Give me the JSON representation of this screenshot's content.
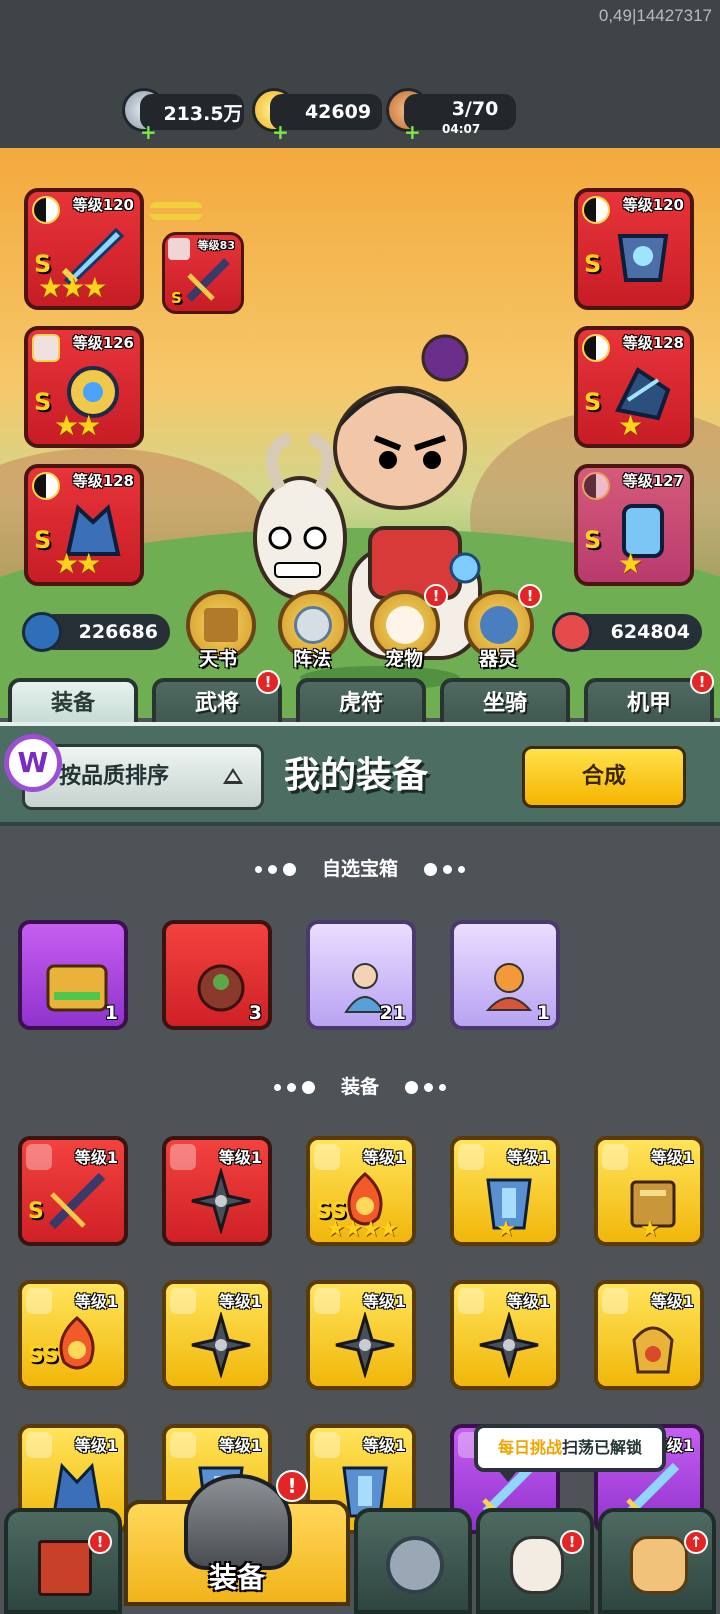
{
  "build_info": "0,49|14427317",
  "resources": {
    "silver": "213.5万",
    "gold": "42609",
    "stamina": "3/70",
    "stamina_timer": "04:07"
  },
  "hero_equipment": {
    "left": [
      {
        "level": "等级120",
        "rank": "S",
        "stars": "★★★",
        "icon": "sword-icon"
      },
      {
        "level": "等级126",
        "rank": "S",
        "stars": "★★",
        "icon": "armor-icon"
      },
      {
        "level": "等级128",
        "rank": "S",
        "stars": "★★",
        "icon": "helmet-icon"
      }
    ],
    "right": [
      {
        "level": "等级120",
        "rank": "S",
        "icon": "armor-icon"
      },
      {
        "level": "等级128",
        "rank": "S",
        "stars": "★",
        "icon": "boots-icon"
      },
      {
        "level": "等级127",
        "rank": "S",
        "stars": "★",
        "icon": "gauntlet-icon"
      }
    ],
    "linked_weapon_level": "等级83",
    "linked_weapon_rank": "S"
  },
  "stats": {
    "attack": "226686",
    "hp": "624804"
  },
  "skill_buttons": [
    {
      "label": "天书",
      "icon": "scroll-icon",
      "badge": false
    },
    {
      "label": "阵法",
      "icon": "formation-icon",
      "badge": false
    },
    {
      "label": "宠物",
      "icon": "cat-icon",
      "badge": true
    },
    {
      "label": "器灵",
      "icon": "spirit-icon",
      "badge": true
    }
  ],
  "tabs": [
    {
      "label": "装备",
      "active": true,
      "badge": false
    },
    {
      "label": "武将",
      "active": false,
      "badge": true
    },
    {
      "label": "虎符",
      "active": false,
      "badge": false
    },
    {
      "label": "坐骑",
      "active": false,
      "badge": false
    },
    {
      "label": "机甲",
      "active": false,
      "badge": true
    }
  ],
  "panel": {
    "sort_label": "按品质排序",
    "title": "我的装备",
    "merge_label": "合成",
    "logo_letter": "W"
  },
  "sections": {
    "chests_title": "自选宝箱",
    "equipment_title": "装备"
  },
  "chests": [
    {
      "count": "1",
      "color": "purple",
      "icon": "chest-icon"
    },
    {
      "count": "3",
      "color": "red",
      "icon": "bag-icon"
    },
    {
      "count": "21",
      "color": "lavender",
      "icon": "hero-fragment-icon"
    },
    {
      "count": "1",
      "color": "lavender",
      "icon": "hero-fragment-icon"
    }
  ],
  "equipment": [
    {
      "level": "等级1",
      "color": "red",
      "rank": "S",
      "icon": "crossbow-icon"
    },
    {
      "level": "等级1",
      "color": "red",
      "icon": "shuriken-icon"
    },
    {
      "level": "等级1",
      "color": "yellow",
      "rank": "SS",
      "stars": "★★★★",
      "icon": "flame-icon"
    },
    {
      "level": "等级1",
      "color": "yellow",
      "stars": "★",
      "icon": "armor-icon"
    },
    {
      "level": "等级1",
      "color": "yellow",
      "stars": "★",
      "icon": "tome-icon"
    },
    {
      "level": "等级1",
      "color": "yellow",
      "rank": "SS",
      "icon": "flame-icon"
    },
    {
      "level": "等级1",
      "color": "yellow",
      "icon": "shuriken-icon"
    },
    {
      "level": "等级1",
      "color": "yellow",
      "icon": "shuriken-icon"
    },
    {
      "level": "等级1",
      "color": "yellow",
      "icon": "shuriken-icon"
    },
    {
      "level": "等级1",
      "color": "yellow",
      "icon": "pouch-icon"
    },
    {
      "level": "等级1",
      "color": "yellow",
      "icon": "helmet-icon"
    },
    {
      "level": "等级1",
      "color": "yellow",
      "icon": "armor-icon"
    },
    {
      "level": "等级1",
      "color": "yellow",
      "icon": "armor-icon"
    },
    {
      "level": "等级1",
      "color": "purple",
      "icon": "sword-icon"
    },
    {
      "level": "等级1",
      "color": "purple",
      "icon": "sword-icon"
    }
  ],
  "tooltip": {
    "highlight": "每日挑战",
    "text": "扫荡已解锁"
  },
  "bottom_nav": [
    {
      "label": "",
      "icon": "gate-icon",
      "badge": true
    },
    {
      "label": "装备",
      "icon": "helmet-icon",
      "badge": true,
      "active": true
    },
    {
      "label": "",
      "icon": "formation-icon",
      "badge": false
    },
    {
      "label": "",
      "icon": "goose-icon",
      "badge": true
    },
    {
      "label": "",
      "icon": "upgrade-fist-icon",
      "badge": true
    }
  ],
  "colors": {
    "background": "#4e5358",
    "panel_green": "#4c6d62",
    "accent_yellow": "#f5b400",
    "rarity_red": "#cf2126",
    "rarity_yellow": "#f1b70b",
    "rarity_purple": "#9033cf",
    "badge_red": "#e42525"
  }
}
